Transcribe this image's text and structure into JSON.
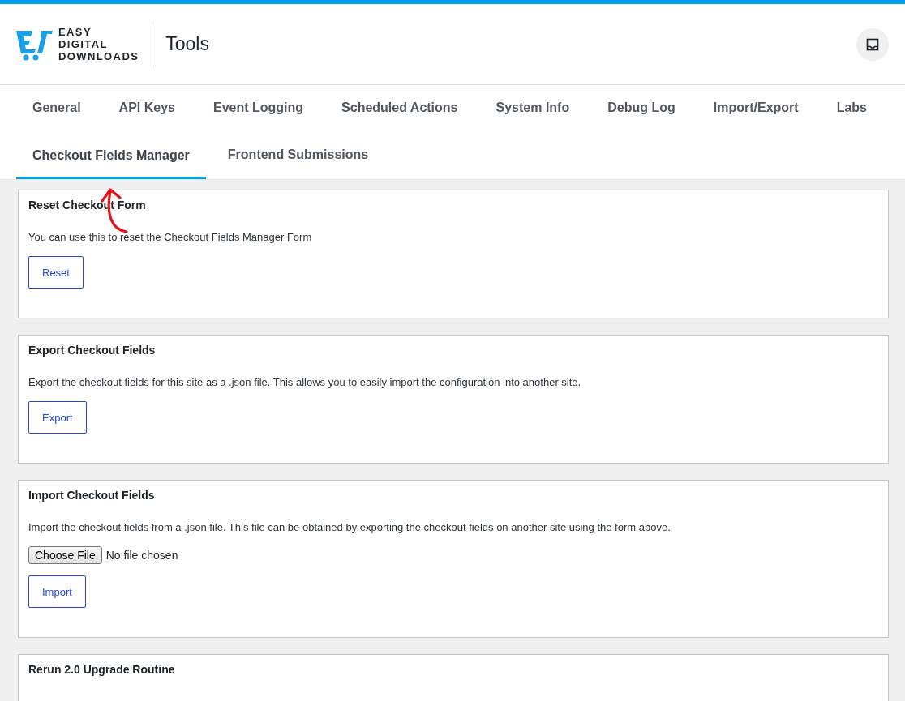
{
  "header": {
    "logo_lines": [
      "EASY",
      "DIGITAL",
      "DOWNLOADS"
    ],
    "title": "Tools"
  },
  "tabs": [
    {
      "label": "General",
      "selected": false
    },
    {
      "label": "API Keys",
      "selected": false
    },
    {
      "label": "Event Logging",
      "selected": false
    },
    {
      "label": "Scheduled Actions",
      "selected": false
    },
    {
      "label": "System Info",
      "selected": false
    },
    {
      "label": "Debug Log",
      "selected": false
    },
    {
      "label": "Import/Export",
      "selected": false
    },
    {
      "label": "Labs",
      "selected": false
    },
    {
      "label": "Checkout Fields Manager",
      "selected": true
    },
    {
      "label": "Frontend Submissions",
      "selected": false
    }
  ],
  "sections": [
    {
      "kind": "action",
      "title": "Reset Checkout Form",
      "description": "You can use this to reset the Checkout Fields Manager Form",
      "button": "Reset"
    },
    {
      "kind": "action",
      "title": "Export Checkout Fields",
      "description": "Export the checkout fields for this site as a .json file. This allows you to easily import the configuration into another site.",
      "button": "Export"
    },
    {
      "kind": "import",
      "title": "Import Checkout Fields",
      "description": "Import the checkout fields from a .json file. This file can be obtained by exporting the checkout fields on another site using the form above.",
      "file_button": "Choose File",
      "file_status": "No file chosen",
      "button": "Import"
    },
    {
      "kind": "text",
      "title": "Rerun 2.0 Upgrade Routine"
    }
  ]
}
